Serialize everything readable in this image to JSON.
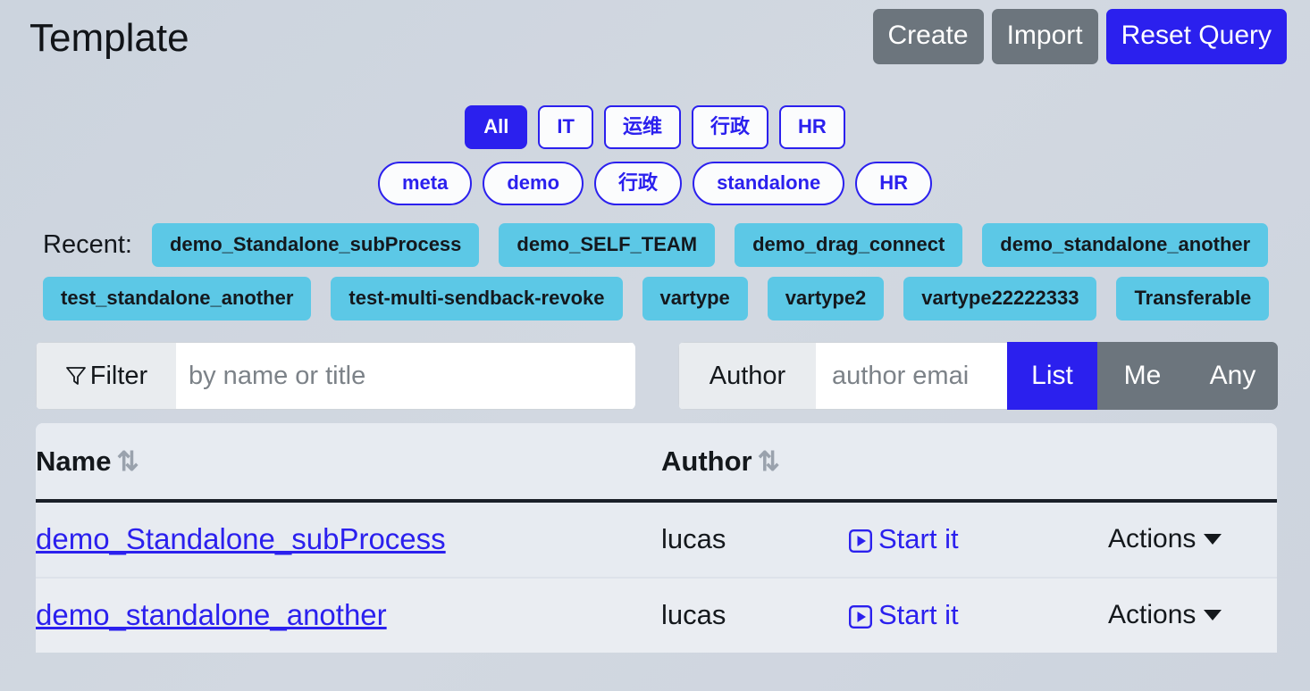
{
  "header": {
    "title": "Template",
    "buttons": [
      {
        "label": "Create",
        "style": "secondary"
      },
      {
        "label": "Import",
        "style": "secondary"
      },
      {
        "label": "Reset Query",
        "style": "primary"
      }
    ]
  },
  "categories_row1": [
    {
      "label": "All",
      "active": true
    },
    {
      "label": "IT",
      "active": false
    },
    {
      "label": "运维",
      "active": false
    },
    {
      "label": "行政",
      "active": false
    },
    {
      "label": "HR",
      "active": false
    }
  ],
  "categories_row2": [
    {
      "label": "meta",
      "active": false
    },
    {
      "label": "demo",
      "active": false
    },
    {
      "label": "行政",
      "active": false
    },
    {
      "label": "standalone",
      "active": false
    },
    {
      "label": "HR",
      "active": false
    }
  ],
  "recent": {
    "label": "Recent:",
    "tags": [
      "demo_Standalone_subProcess",
      "demo_SELF_TEAM",
      "demo_drag_connect",
      "demo_standalone_another",
      "test_standalone_another",
      "test-multi-sendback-revoke",
      "vartype",
      "vartype2",
      "vartype22222333",
      "Transferable"
    ]
  },
  "filter": {
    "addon_label": "Filter",
    "icon": "funnel-icon",
    "placeholder": "by name or title",
    "value": ""
  },
  "author_filter": {
    "addon_label": "Author",
    "placeholder": "author emai",
    "value": "",
    "buttons": [
      {
        "label": "List",
        "selected": true
      },
      {
        "label": "Me",
        "selected": false
      },
      {
        "label": "Any",
        "selected": false
      }
    ]
  },
  "table": {
    "columns": [
      {
        "label": "Name",
        "sort_icon": "⇅"
      },
      {
        "label": "Author",
        "sort_icon": "⇅"
      }
    ],
    "rows": [
      {
        "name": "demo_Standalone_subProcess",
        "author": "lucas",
        "start_label": "Start it",
        "actions_label": "Actions"
      },
      {
        "name": "demo_standalone_another",
        "author": "lucas",
        "start_label": "Start it",
        "actions_label": "Actions"
      }
    ]
  },
  "colors": {
    "primary": "#2b20ee",
    "secondary": "#6c757d",
    "recent_tag": "#5cc8e6",
    "page_bg": "#ccd4de",
    "table_bg": "#e7ebf1"
  }
}
